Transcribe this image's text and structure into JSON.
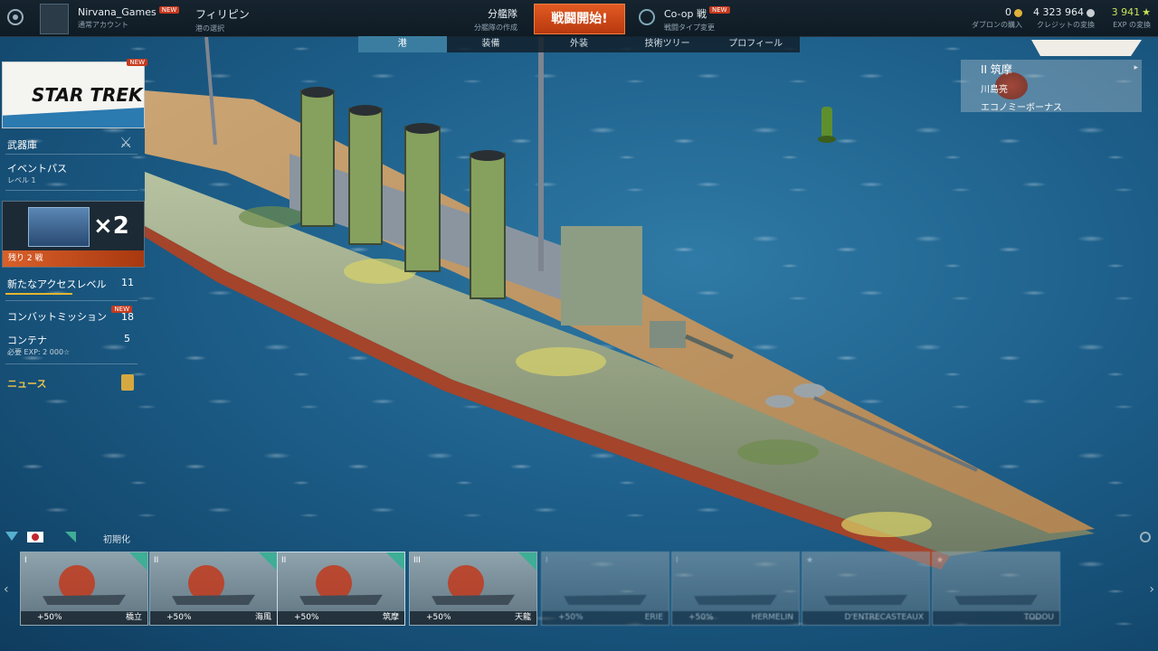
{
  "topbar": {
    "account_name": "Nirvana_Games",
    "account_sub": "通常アカウント",
    "new": "NEW",
    "nation": "フィリピン",
    "nation_sub": "港の選択",
    "division": "分艦隊",
    "division_sub": "分艦隊の作成",
    "battle": "戦闘開始!",
    "mode": "Co-op 戦",
    "mode_sub": "戦闘タイプ変更",
    "doubloons": "0",
    "doubloons_sub": "ダブロンの購入",
    "credits": "4 323 964",
    "credits_sub": "クレジットの変換",
    "exp": "3 941",
    "exp_sub": "EXP の変換"
  },
  "tabs": [
    "港",
    "装備",
    "外装",
    "技術ツリー",
    "プロフィール"
  ],
  "left": {
    "banner_new": "NEW",
    "banner_text": "STAR TREK",
    "armory": "武器庫",
    "event_pass": "イベントパス",
    "event_level": "レベル 1",
    "crate_count": "×2",
    "crate_remaining": "残り 2 戦",
    "access_level": "新たなアクセスレベル",
    "access_count": "11",
    "combat_missions": "コンバットミッション",
    "missions_new": "NEW",
    "missions_count": "18",
    "containers": "コンテナ",
    "containers_count": "5",
    "containers_req": "必要 EXP: 2 000☆",
    "news": "ニュース"
  },
  "shipinfo": {
    "name": "II 筑摩",
    "commander": "川島亮",
    "bonus": "エコノミーボーナス"
  },
  "filter": {
    "reset": "初期化"
  },
  "ships": [
    {
      "tier": "I",
      "name": "橋立",
      "bonus": "+50%"
    },
    {
      "tier": "II",
      "name": "海風",
      "bonus": "+50%"
    },
    {
      "tier": "II",
      "name": "筑摩",
      "bonus": "+50%"
    },
    {
      "tier": "III",
      "name": "天龍",
      "bonus": "+50%"
    },
    {
      "tier": "I",
      "name": "ERIE",
      "bonus": "+50%"
    },
    {
      "tier": "I",
      "name": "HERMELIN",
      "bonus": "+50%"
    },
    {
      "tier": "★",
      "name": "D'ENTRECASTEAUX",
      "bonus": ""
    },
    {
      "tier": "★",
      "name": "TODOU",
      "bonus": ""
    }
  ],
  "colors": {
    "battle": "#d64a1a",
    "accent": "#3b7da0",
    "premium_corner": "#3fae96"
  }
}
